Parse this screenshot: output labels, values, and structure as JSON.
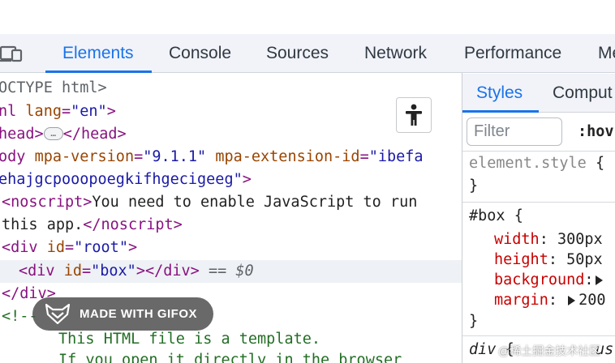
{
  "tabs": [
    {
      "label": "Elements",
      "active": true
    },
    {
      "label": "Console",
      "active": false
    },
    {
      "label": "Sources",
      "active": false
    },
    {
      "label": "Network",
      "active": false
    },
    {
      "label": "Performance",
      "active": false
    },
    {
      "label": "Me",
      "active": false
    }
  ],
  "dom": {
    "doctype": "OCTYPE html>",
    "html_open": {
      "tag_start": "nl",
      "attr": "lang",
      "value": "\"en\"",
      "close": ">"
    },
    "head": {
      "open": "head>",
      "ellipsis": "…",
      "close": "</head>"
    },
    "body_open": {
      "tag_start": "ody",
      "attr1": "mpa-version",
      "val1": "\"9.1.1\"",
      "attr2": "mpa-extension-id",
      "val2": "\"ibefa",
      "val2_cont": "ehajgcpooopoegkifhgecigeeg\"",
      "close": ">"
    },
    "noscript": {
      "open": "<noscript>",
      "text1": "You need to enable JavaScript to run",
      "text2": "this app.",
      "close": "</noscript>"
    },
    "div_root": {
      "tag": "<div",
      "attr": "id",
      "value": "\"root\"",
      "close": ">"
    },
    "div_box": {
      "tag": "<div",
      "attr": "id",
      "value": "\"box\"",
      "close": "></div>",
      "eq": "==",
      "ref": "$0"
    },
    "div_close": "</div>",
    "comment_start": "<!--",
    "comment_lines": [
      "This HTML file is a template.",
      "If you open it directly in the browser"
    ]
  },
  "side": {
    "tabs": [
      {
        "label": "Styles",
        "active": true
      },
      {
        "label": "Comput",
        "active": false
      }
    ],
    "filter_placeholder": "Filter",
    "hov": ":hov",
    "element_style": "element.style",
    "open_brace": "{",
    "close_brace": "}",
    "rule_selector": "#box",
    "props": [
      {
        "name": "width",
        "value": "300px"
      },
      {
        "name": "height",
        "value": "50px"
      },
      {
        "name": "background",
        "value": ""
      },
      {
        "name": "margin",
        "value": "200"
      }
    ],
    "next_selector": "div",
    "next_origin": "us"
  },
  "watermark": {
    "label": "MADE WITH GIFOX"
  },
  "corner_watermark": "@稀土掘金技术社区"
}
